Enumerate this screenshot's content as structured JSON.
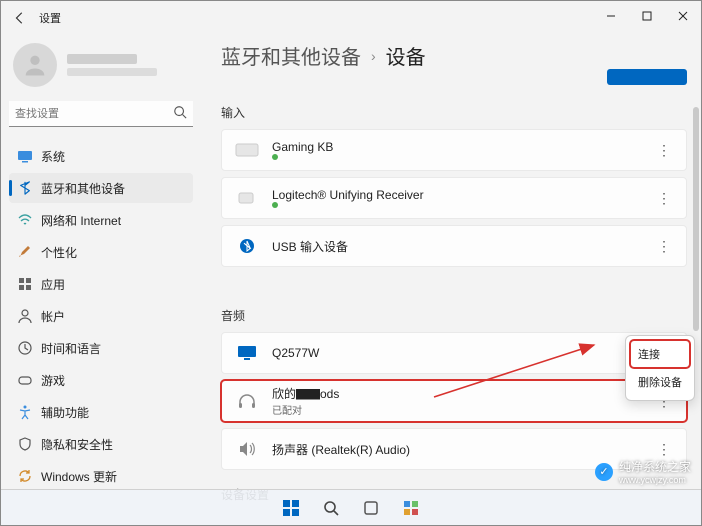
{
  "window": {
    "title": "设置"
  },
  "sidebar": {
    "search_placeholder": "查找设置",
    "items": [
      {
        "label": "系统"
      },
      {
        "label": "蓝牙和其他设备"
      },
      {
        "label": "网络和 Internet"
      },
      {
        "label": "个性化"
      },
      {
        "label": "应用"
      },
      {
        "label": "帐户"
      },
      {
        "label": "时间和语言"
      },
      {
        "label": "游戏"
      },
      {
        "label": "辅助功能"
      },
      {
        "label": "隐私和安全性"
      },
      {
        "label": "Windows 更新"
      }
    ]
  },
  "breadcrumb": {
    "parent": "蓝牙和其他设备",
    "current": "设备"
  },
  "sections": {
    "input": {
      "title": "输入",
      "devices": [
        {
          "name": "Gaming KB",
          "status_dot": true
        },
        {
          "name": "Logitech® Unifying Receiver",
          "status_dot": true
        },
        {
          "name": "USB 输入设备"
        }
      ]
    },
    "audio": {
      "title": "音频",
      "devices": [
        {
          "name": "Q2577W"
        },
        {
          "name": "欣的▇▇ods",
          "status": "已配对"
        },
        {
          "name": "扬声器 (Realtek(R) Audio)"
        }
      ]
    },
    "device_settings": {
      "title": "设备设置"
    }
  },
  "context_menu": {
    "connect": "连接",
    "remove": "删除设备"
  },
  "watermark": {
    "text": "纯净系统之家",
    "url": "www.ycwjzy.com"
  },
  "colors": {
    "accent": "#0067c0",
    "highlight_red": "#d7322e"
  }
}
